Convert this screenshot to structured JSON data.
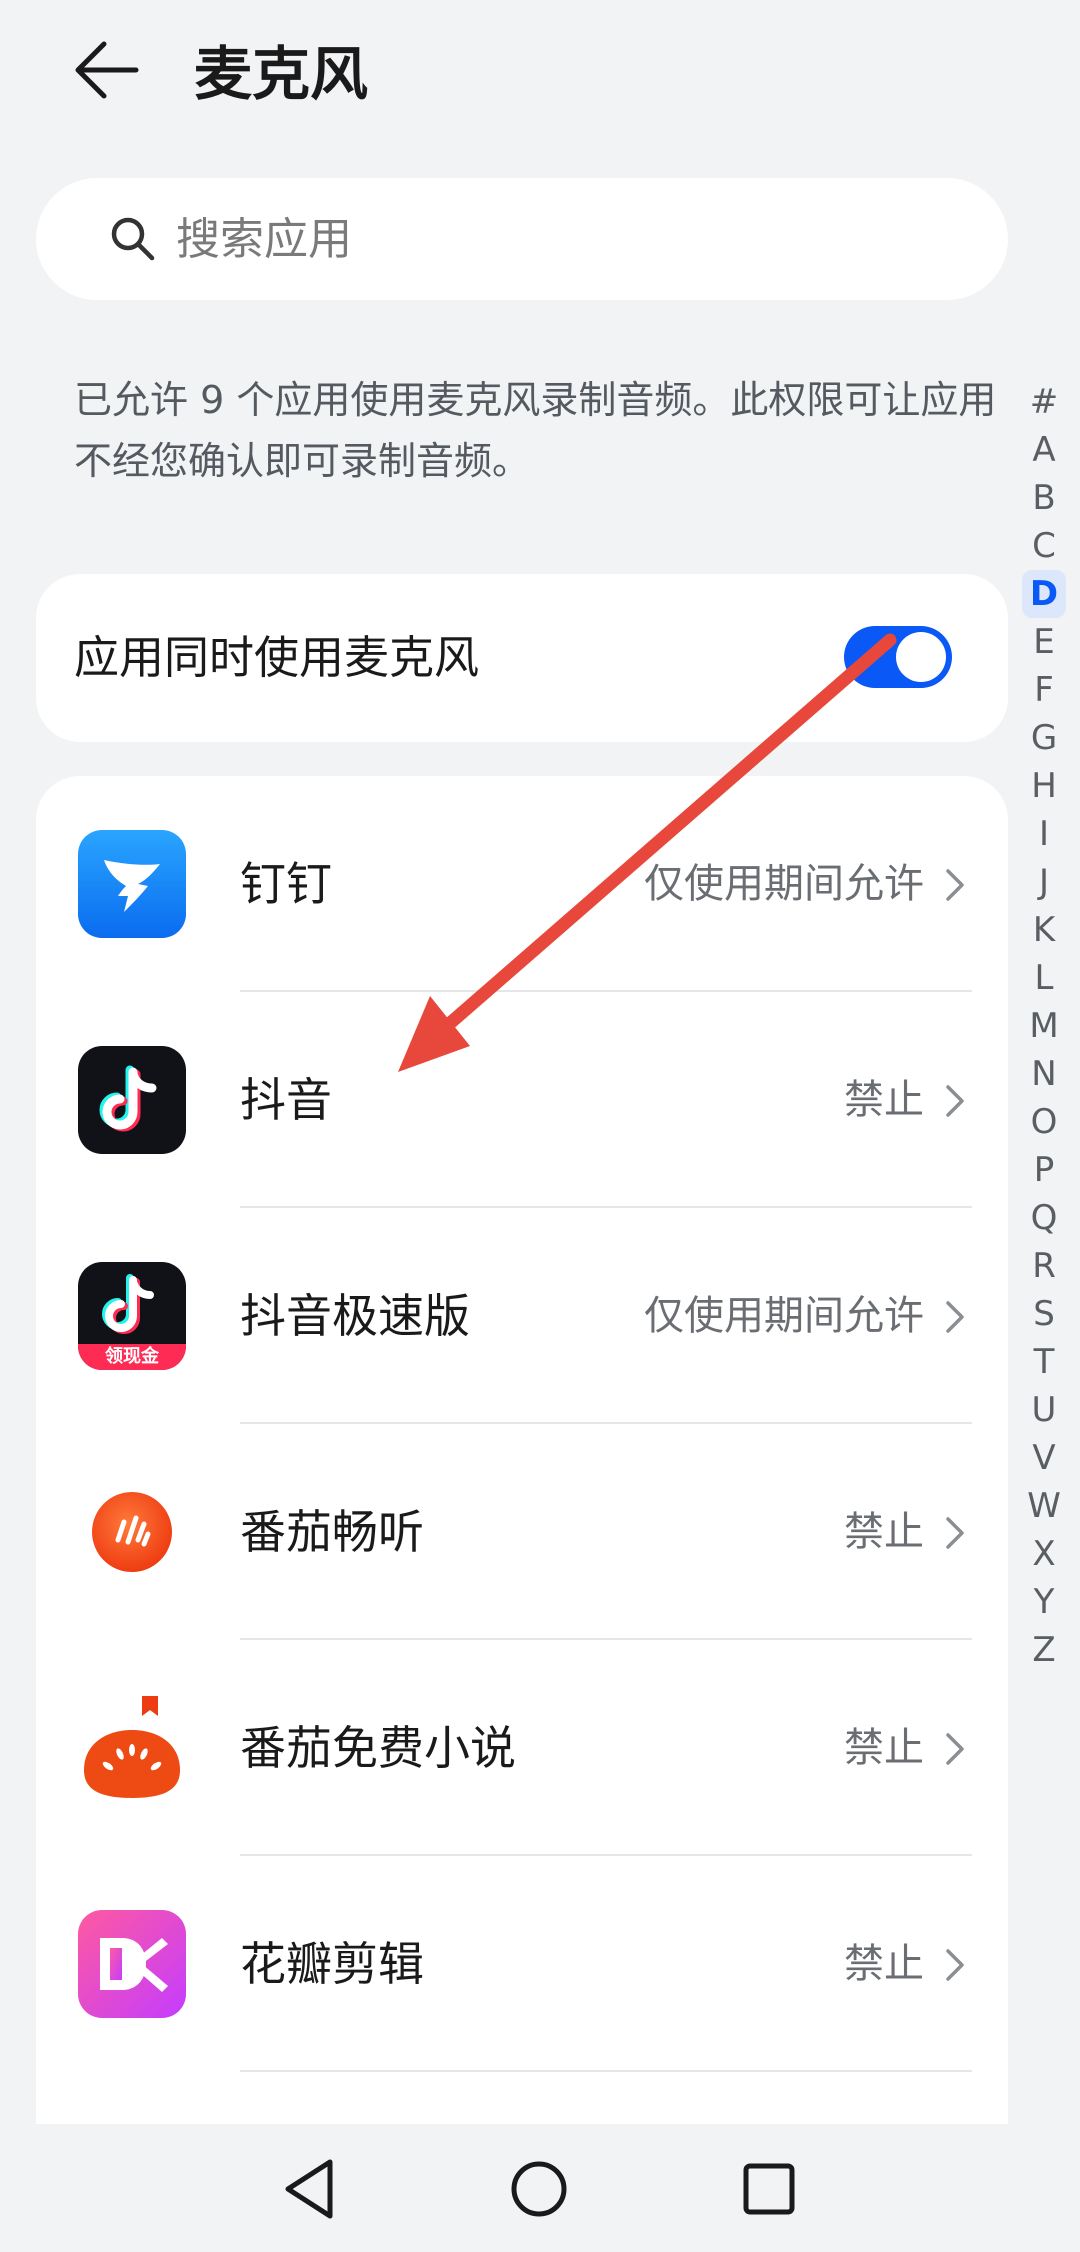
{
  "header": {
    "title": "麦克风",
    "back_icon": "arrow-left-icon"
  },
  "search": {
    "placeholder": "搜索应用",
    "value": "",
    "icon": "search-icon"
  },
  "description": "已允许 9 个应用使用麦克风录制音频。此权限可让应用不经您确认即可录制音频。",
  "simultaneous_use": {
    "label": "应用同时使用麦克风",
    "enabled": true
  },
  "apps": [
    {
      "name": "钉钉",
      "status": "仅使用期间允许",
      "icon": "dingtalk-icon"
    },
    {
      "name": "抖音",
      "status": "禁止",
      "icon": "douyin-icon"
    },
    {
      "name": "抖音极速版",
      "status": "仅使用期间允许",
      "icon": "douyin-lite-icon",
      "icon_badge": "领现金"
    },
    {
      "name": "番茄畅听",
      "status": "禁止",
      "icon": "fanqie-changting-icon"
    },
    {
      "name": "番茄免费小说",
      "status": "禁止",
      "icon": "fanqie-novel-icon"
    },
    {
      "name": "花瓣剪辑",
      "status": "禁止",
      "icon": "huaban-jianji-icon"
    }
  ],
  "alpha_index": {
    "letters": [
      "#",
      "A",
      "B",
      "C",
      "D",
      "E",
      "F",
      "G",
      "H",
      "I",
      "J",
      "K",
      "L",
      "M",
      "N",
      "O",
      "P",
      "Q",
      "R",
      "S",
      "T",
      "U",
      "V",
      "W",
      "X",
      "Y",
      "Z"
    ],
    "active": "D"
  },
  "nav": {
    "back": "triangle-back-icon",
    "home": "circle-home-icon",
    "recents": "square-recents-icon"
  },
  "colors": {
    "accent": "#0a59f7",
    "annotation_arrow": "#e8473b",
    "background": "#f1f3f5"
  }
}
